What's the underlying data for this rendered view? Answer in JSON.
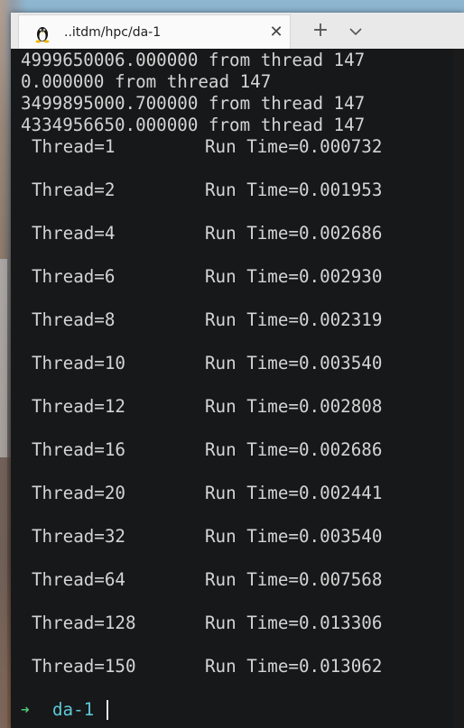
{
  "tab": {
    "title": "..itdm/hpc/da-1",
    "icon": "linux-tux-icon",
    "close_icon": "close-icon"
  },
  "toolbar": {
    "new_tab_icon": "plus-icon",
    "dropdown_icon": "chevron-down-icon"
  },
  "output_lines": [
    "4999650006.000000 from thread 147",
    "0.000000 from thread 147",
    "3499895000.700000 from thread 147",
    "4334956650.000000 from thread 147"
  ],
  "results": [
    {
      "thread": "Thread=1",
      "run_time": "Run Time=0.000732"
    },
    {
      "thread": "Thread=2",
      "run_time": "Run Time=0.001953"
    },
    {
      "thread": "Thread=4",
      "run_time": "Run Time=0.002686"
    },
    {
      "thread": "Thread=6",
      "run_time": "Run Time=0.002930"
    },
    {
      "thread": "Thread=8",
      "run_time": "Run Time=0.002319"
    },
    {
      "thread": "Thread=10",
      "run_time": "Run Time=0.003540"
    },
    {
      "thread": "Thread=12",
      "run_time": "Run Time=0.002808"
    },
    {
      "thread": "Thread=16",
      "run_time": "Run Time=0.002686"
    },
    {
      "thread": "Thread=20",
      "run_time": "Run Time=0.002441"
    },
    {
      "thread": "Thread=32",
      "run_time": "Run Time=0.003540"
    },
    {
      "thread": "Thread=64",
      "run_time": "Run Time=0.007568"
    },
    {
      "thread": "Thread=128",
      "run_time": "Run Time=0.013306"
    },
    {
      "thread": "Thread=150",
      "run_time": "Run Time=0.013062"
    }
  ],
  "prompt": {
    "arrow": "➜",
    "directory": "da-1"
  },
  "colors": {
    "prompt_arrow": "#4ec97a",
    "prompt_dir": "#5ec8d8",
    "text": "#d4d4d4"
  }
}
